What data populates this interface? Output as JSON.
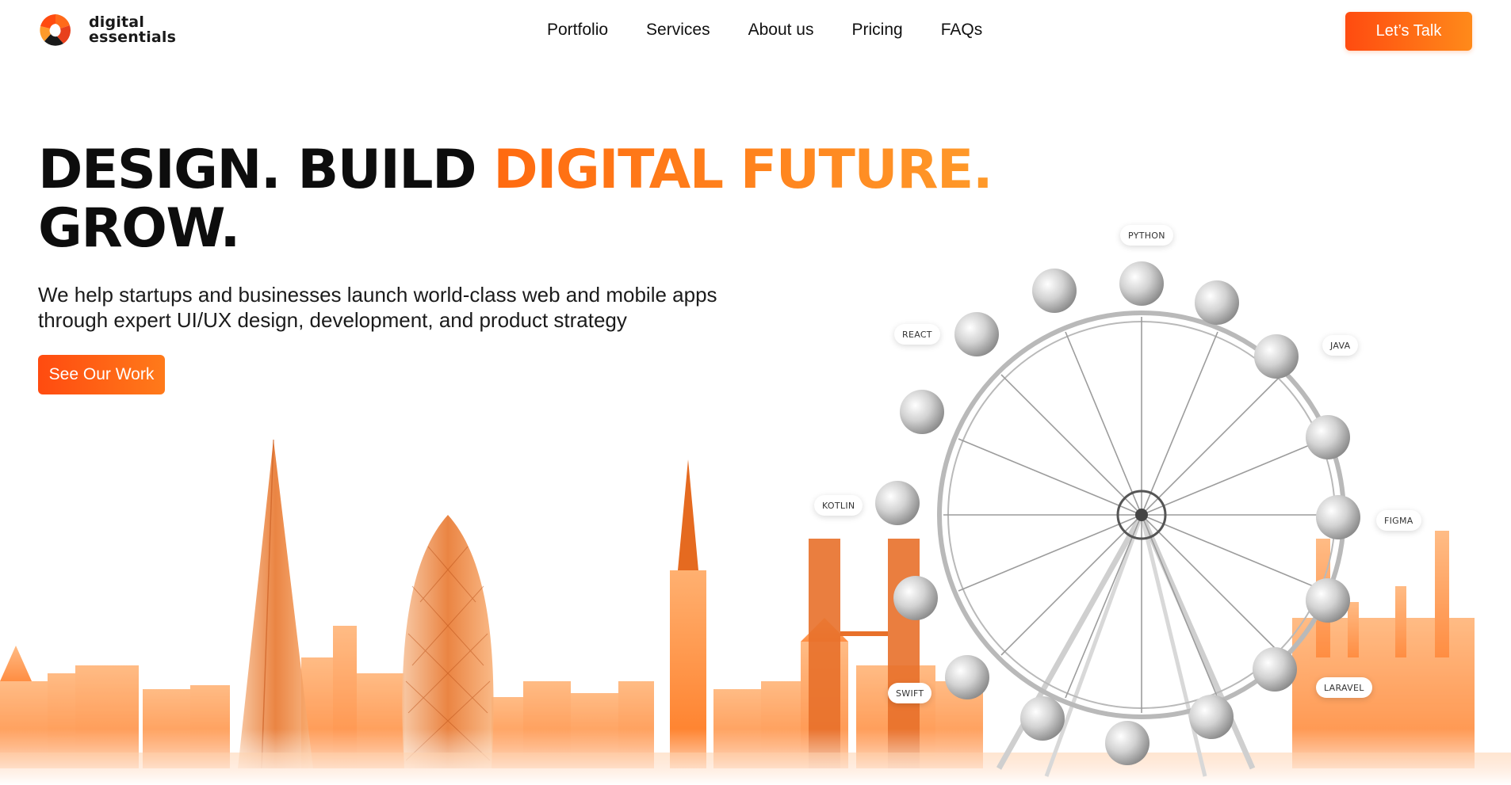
{
  "brand": {
    "line1": "digital",
    "line2": "essentials",
    "logo_icon": "swirl-logo-icon"
  },
  "nav": {
    "items": [
      "Portfolio",
      "Services",
      "About us",
      "Pricing",
      "FAQs"
    ]
  },
  "header": {
    "cta_label": "Let’s Talk"
  },
  "hero": {
    "headline_part1": "DESIGN. BUILD ",
    "headline_accent": "DIGITAL FUTURE.",
    "headline_line2": "GROW.",
    "subtitle": "We help startups and businesses launch world-class web and mobile apps through expert UI/UX design, development, and product strategy",
    "cta_label": "See Our Work"
  },
  "tech_tags": [
    "PYTHON",
    "REACT",
    "JAVA",
    "KOTLIN",
    "FIGMA",
    "SWIFT",
    "LARAVEL"
  ],
  "colors": {
    "accent": "#ff7a1a",
    "accent_dark": "#ff4b10",
    "text": "#111111"
  }
}
